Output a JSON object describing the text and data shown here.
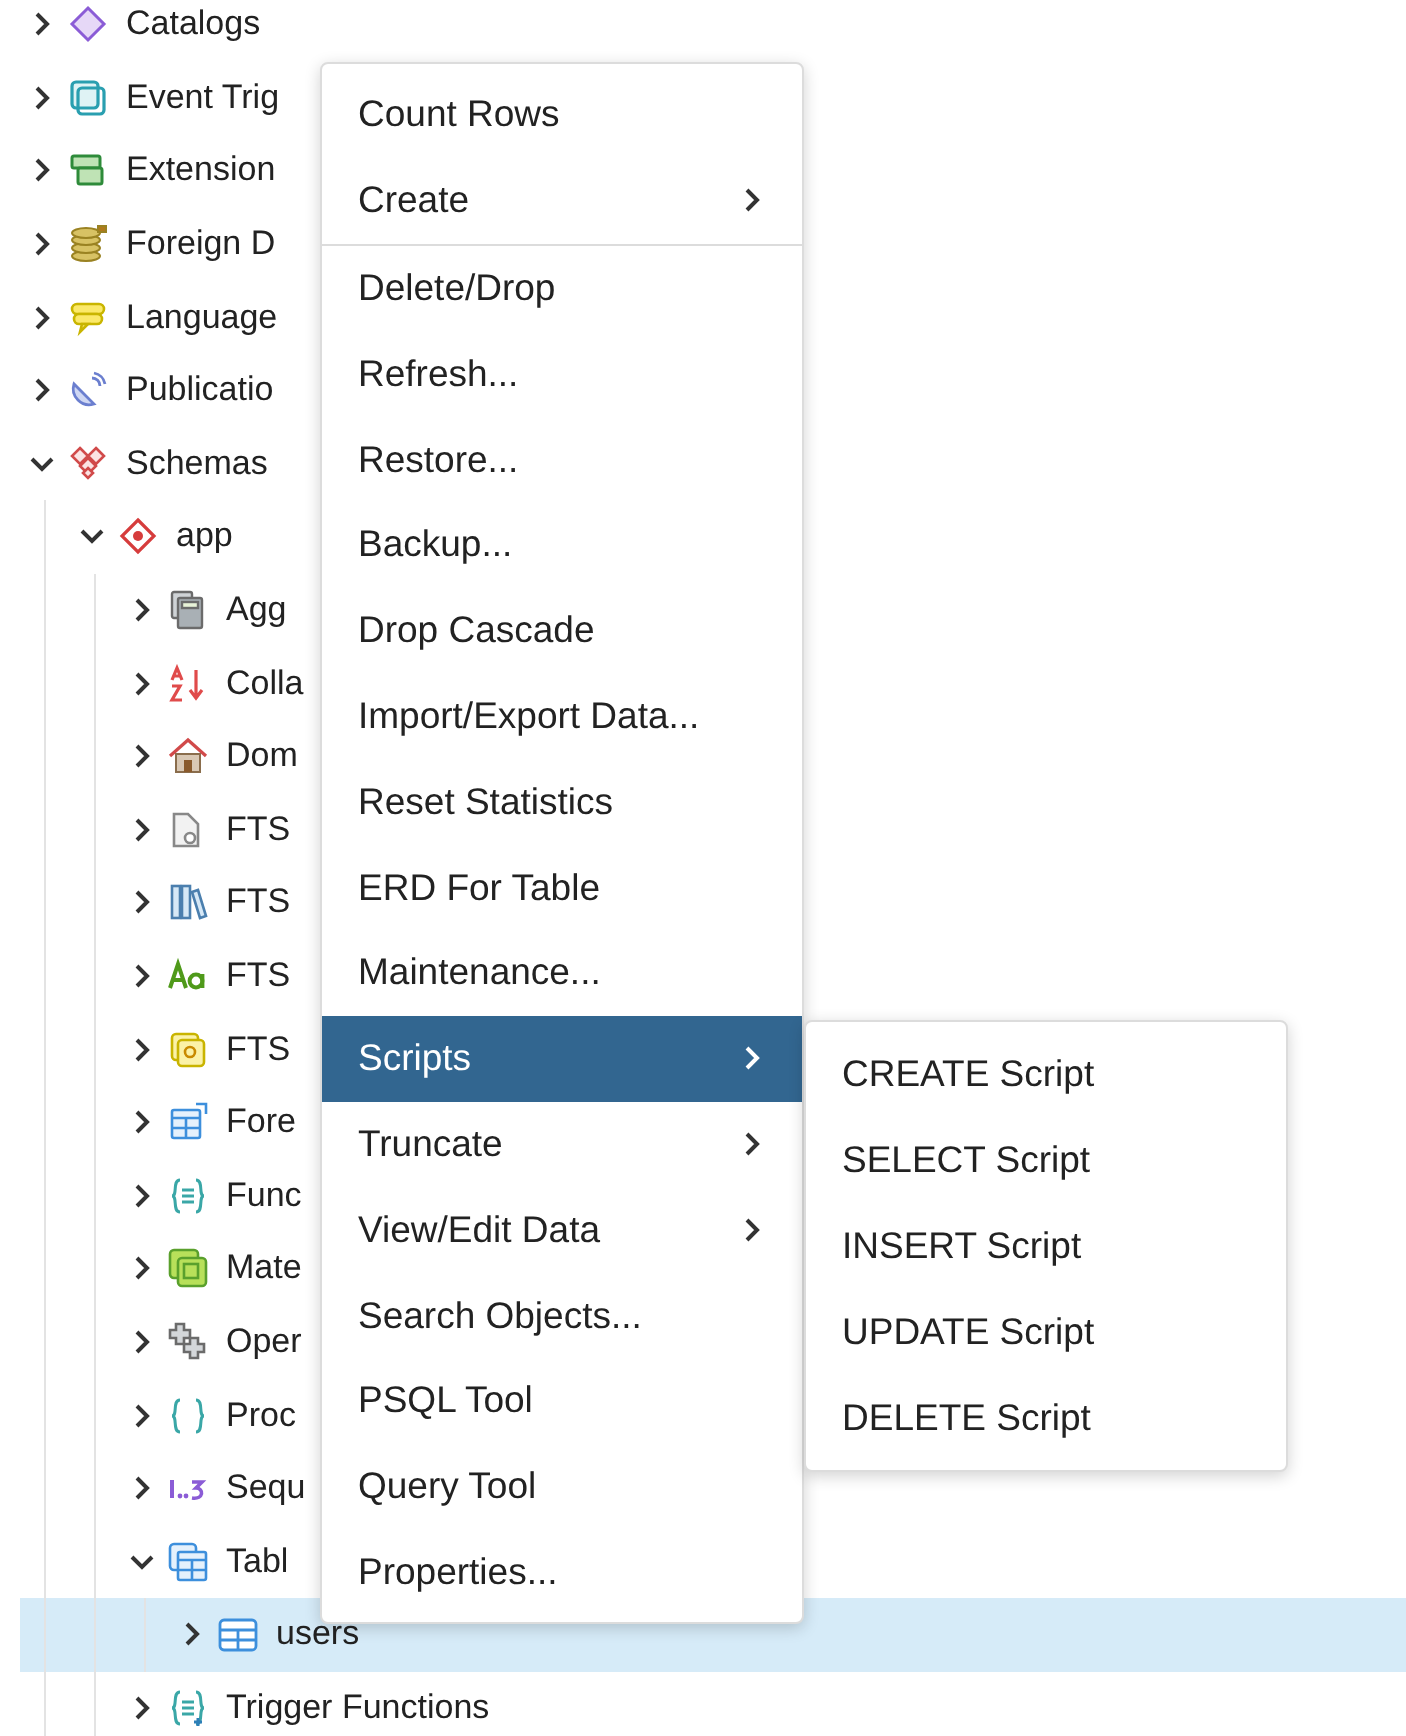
{
  "tree": [
    {
      "label": "Catalogs",
      "kind": "catalogs",
      "expanded": false
    },
    {
      "label": "Event Trig",
      "kind": "event_triggers",
      "expanded": false
    },
    {
      "label": "Extension",
      "kind": "extensions",
      "expanded": false
    },
    {
      "label": "Foreign D",
      "kind": "foreign_data",
      "expanded": false
    },
    {
      "label": "Language",
      "kind": "languages",
      "expanded": false
    },
    {
      "label": "Publicatio",
      "kind": "publications",
      "expanded": false
    },
    {
      "label": "Schemas",
      "kind": "schemas",
      "expanded": true,
      "children": [
        {
          "label": "app",
          "kind": "schema",
          "expanded": true,
          "children": [
            {
              "label": "Agg",
              "kind": "aggregates",
              "expanded": false
            },
            {
              "label": "Colla",
              "kind": "collations",
              "expanded": false
            },
            {
              "label": "Dom",
              "kind": "domains",
              "expanded": false
            },
            {
              "label": "FTS",
              "kind": "fts_configurations",
              "expanded": false
            },
            {
              "label": "FTS",
              "kind": "fts_dictionaries",
              "expanded": false
            },
            {
              "label": "FTS",
              "kind": "fts_parsers",
              "expanded": false
            },
            {
              "label": "FTS",
              "kind": "fts_templates",
              "expanded": false
            },
            {
              "label": "Fore",
              "kind": "foreign_tables",
              "expanded": false
            },
            {
              "label": "Func",
              "kind": "functions",
              "expanded": false
            },
            {
              "label": "Mate",
              "kind": "materialized_views",
              "expanded": false
            },
            {
              "label": "Oper",
              "kind": "operators",
              "expanded": false
            },
            {
              "label": "Proc",
              "kind": "procedures",
              "expanded": false
            },
            {
              "label": "Sequ",
              "kind": "sequences",
              "expanded": false
            },
            {
              "label": "Tabl",
              "kind": "tables",
              "expanded": true,
              "children": [
                {
                  "label": "users",
                  "kind": "table",
                  "expanded": false,
                  "selected": true
                }
              ]
            },
            {
              "label": "Trigger Functions",
              "kind": "trigger_functions",
              "expanded": false
            }
          ]
        }
      ]
    }
  ],
  "context_menu": {
    "sections": [
      [
        {
          "label": "Count Rows",
          "submenu": false,
          "selected": false
        },
        {
          "label": "Create",
          "submenu": true,
          "selected": false
        }
      ],
      [
        {
          "label": "Delete/Drop",
          "submenu": false,
          "selected": false
        },
        {
          "label": "Refresh...",
          "submenu": false,
          "selected": false
        },
        {
          "label": "Restore...",
          "submenu": false,
          "selected": false
        },
        {
          "label": "Backup...",
          "submenu": false,
          "selected": false
        },
        {
          "label": "Drop Cascade",
          "submenu": false,
          "selected": false
        },
        {
          "label": "Import/Export Data...",
          "submenu": false,
          "selected": false
        },
        {
          "label": "Reset Statistics",
          "submenu": false,
          "selected": false
        },
        {
          "label": "ERD For Table",
          "submenu": false,
          "selected": false
        },
        {
          "label": "Maintenance...",
          "submenu": false,
          "selected": false
        },
        {
          "label": "Scripts",
          "submenu": true,
          "selected": true
        },
        {
          "label": "Truncate",
          "submenu": true,
          "selected": false
        },
        {
          "label": "View/Edit Data",
          "submenu": true,
          "selected": false
        },
        {
          "label": "Search Objects...",
          "submenu": false,
          "selected": false
        },
        {
          "label": "PSQL Tool",
          "submenu": false,
          "selected": false
        },
        {
          "label": "Query Tool",
          "submenu": false,
          "selected": false
        },
        {
          "label": "Properties...",
          "submenu": false,
          "selected": false
        }
      ]
    ]
  },
  "submenu": {
    "items": [
      {
        "label": "CREATE Script"
      },
      {
        "label": "SELECT Script"
      },
      {
        "label": "INSERT Script"
      },
      {
        "label": "UPDATE Script"
      },
      {
        "label": "DELETE Script"
      }
    ]
  }
}
